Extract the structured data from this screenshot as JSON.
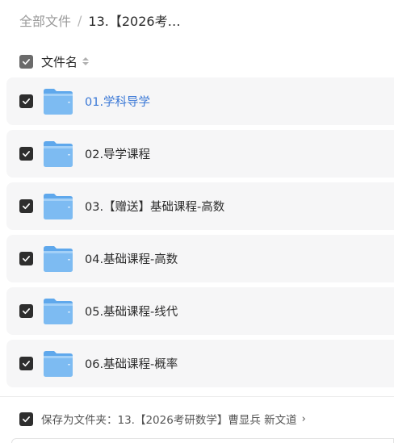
{
  "breadcrumb": {
    "root": "全部文件",
    "separator": "/",
    "current": "13.【2026考…"
  },
  "list_header": {
    "label": "文件名",
    "select_all_state": "partial"
  },
  "files": [
    {
      "name": "01.学科导学",
      "checked": true,
      "hovered": true
    },
    {
      "name": "02.导学课程",
      "checked": true
    },
    {
      "name": "03.【赠送】基础课程-高数",
      "checked": true
    },
    {
      "name": "04.基础课程-高数",
      "checked": true
    },
    {
      "name": "05.基础课程-线代",
      "checked": true
    },
    {
      "name": "06.基础课程-概率",
      "checked": true
    }
  ],
  "footer": {
    "save_label": "保存为文件夹：13.【2026考研数学】曹显兵 新文道",
    "arrow": "›",
    "checked": true
  },
  "colors": {
    "checkbox": "#2e2e2e",
    "row_bg": "#f6f6f7",
    "link": "#3a78d6",
    "folder_main": "#7dbbf2",
    "folder_tab": "#5fa8ec"
  },
  "icons": {
    "folder": "folder-icon",
    "check": "check-icon",
    "sort": "sort-icon"
  }
}
